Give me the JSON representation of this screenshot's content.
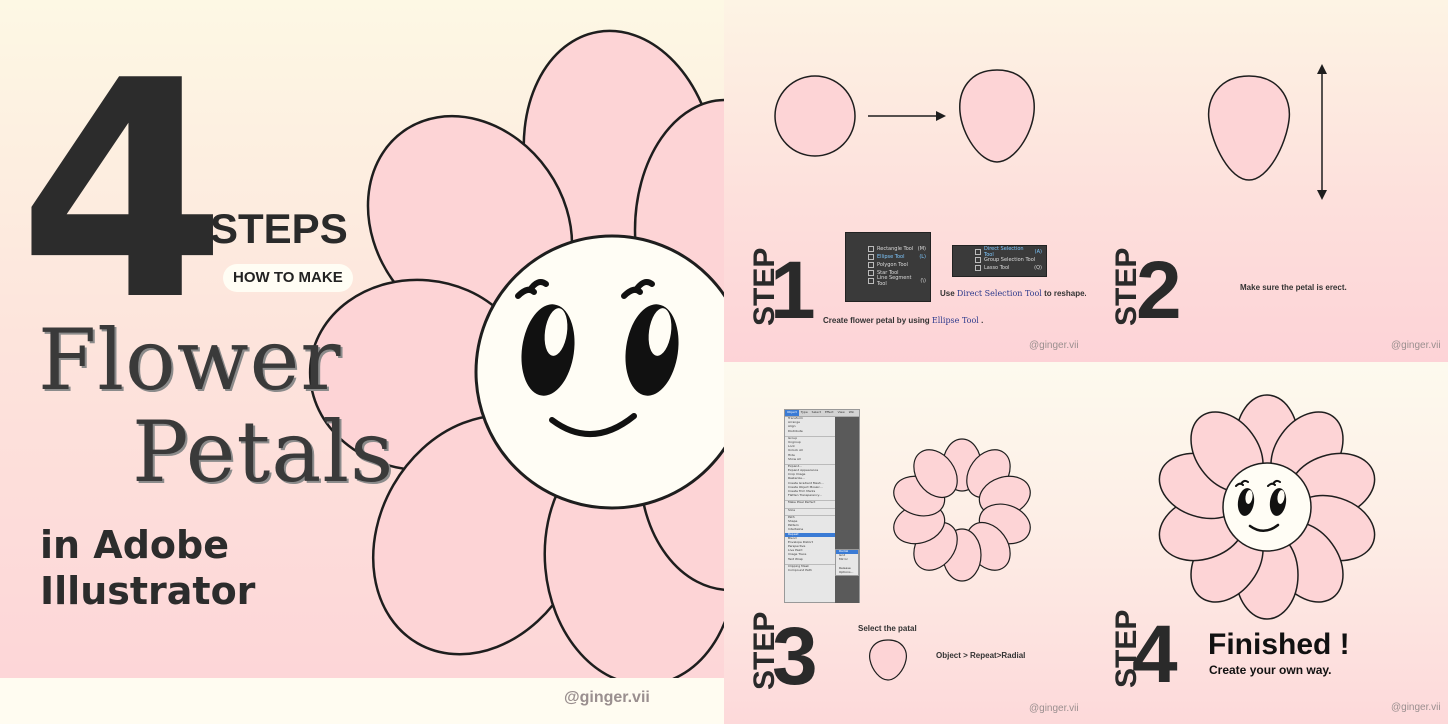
{
  "cover": {
    "number": "4",
    "steps": "STEPS",
    "how_to_make": "HOW TO MAKE",
    "title_line1": "Flower",
    "title_line2": "Petals",
    "subtitle": "in Adobe\nIllustrator",
    "handle": "@ginger.vii"
  },
  "step1": {
    "label": "STEP",
    "number": "1",
    "caption_prefix": "Create flower petal by using ",
    "caption_tool": "Ellipse Tool",
    "caption_suffix": " .",
    "reshape_prefix": "Use ",
    "reshape_tool": "Direct Selection Tool",
    "reshape_suffix": " to reshape.",
    "tools_menu": [
      {
        "label": "Rectangle Tool",
        "key": "(M)"
      },
      {
        "label": "Ellipse Tool",
        "key": "(L)"
      },
      {
        "label": "Polygon Tool",
        "key": ""
      },
      {
        "label": "Star Tool",
        "key": ""
      },
      {
        "label": "Line Segment Tool",
        "key": "(\\)"
      }
    ],
    "selection_menu": [
      {
        "label": "Direct Selection Tool",
        "key": "(A)"
      },
      {
        "label": "Group Selection Tool",
        "key": ""
      },
      {
        "label": "Lasso Tool",
        "key": "(Q)"
      }
    ],
    "handle": "@ginger.vii"
  },
  "step2": {
    "label": "STEP",
    "number": "2",
    "caption": "Make sure the petal is erect.",
    "handle": "@ginger.vii"
  },
  "step3": {
    "label": "STEP",
    "number": "3",
    "select_caption": "Select the patal",
    "path_caption": "Object > Repeat>Radial",
    "menubar": [
      "Object",
      "Type",
      "Select",
      "Effect",
      "View",
      "Win"
    ],
    "object_menu": [
      "Transform",
      "Arrange",
      "Align",
      "Distribute",
      "",
      "Group",
      "Ungroup",
      "Lock",
      "Unlock All",
      "Hide",
      "Show All",
      "",
      "Expand...",
      "Expand Appearance",
      "Crop Image",
      "Rasterize...",
      "Create Gradient Mesh...",
      "Create Object Mosaic...",
      "Create Trim Marks",
      "Flatten Transparency...",
      "",
      "Make Pixel Perfect",
      "",
      "Slice",
      "",
      "Path",
      "Shape",
      "Pattern",
      "Intertwine",
      "Repeat",
      "Blend",
      "Envelope Distort",
      "Perspective",
      "Live Paint",
      "Image Trace",
      "Text Wrap",
      "",
      "Clipping Mask",
      "Compound Path"
    ],
    "submenu": [
      "Radial",
      "Grid",
      "Mirror",
      "",
      "Release",
      "Options..."
    ],
    "handle": "@ginger.vii"
  },
  "step4": {
    "label": "STEP",
    "number": "4",
    "finished": "Finished !",
    "create": "Create your own way.",
    "handle": "@ginger.vii"
  },
  "colors": {
    "petal": "#fdd4d6",
    "outline": "#1e1e1e",
    "face": "#fffdf5",
    "ink": "#111111"
  }
}
